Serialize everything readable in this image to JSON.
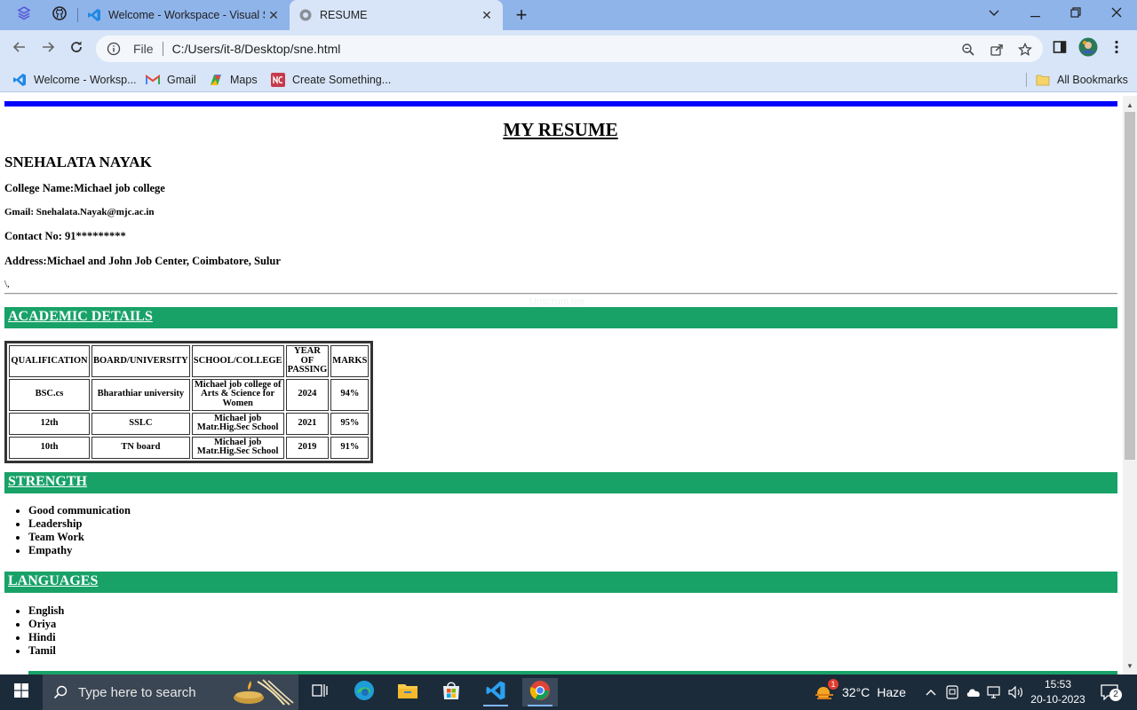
{
  "browser": {
    "tabs": [
      {
        "title": "Welcome - Workspace - Visual S",
        "icon": "vscode-icon"
      },
      {
        "title": "RESUME",
        "icon": "globe-icon"
      }
    ],
    "address_scheme": "File",
    "address_url": "C:/Users/it-8/Desktop/sne.html",
    "bookmarks": [
      {
        "label": "Welcome - Worksp...",
        "icon": "vscode-icon"
      },
      {
        "label": "Gmail",
        "icon": "gmail-icon"
      },
      {
        "label": "Maps",
        "icon": "maps-icon"
      },
      {
        "label": "Create Something...",
        "icon": "create-icon"
      }
    ],
    "all_bookmarks_label": "All Bookmarks"
  },
  "resume": {
    "title": "MY RESUME",
    "name": "SNEHALATA NAYAK",
    "college": "College Name:Michael job college",
    "gmail": "Gmail: Snehalata.Nayak@mjc.ac.in",
    "contact": "Contact No: 91*********",
    "address": "Address:Michael and John Job Center, Coimbatore, Sulur",
    "stray_mark": "\\,",
    "ghost_text": "Unscrum.tee",
    "sections": {
      "academic": "ACADEMIC DETAILS",
      "strength": "STRENGTH",
      "languages": "LANGUAGES"
    },
    "table": {
      "headers": [
        "QUALIFICATION",
        "BOARD/UNIVERSITY",
        "SCHOOL/COLLEGE",
        "YEAR OF PASSING",
        "MARKS"
      ],
      "rows": [
        [
          "BSC.cs",
          "Bharathiar university",
          "Michael job college of Arts & Science for Women",
          "2024",
          "94%"
        ],
        [
          "12th",
          "SSLC",
          "Michael job Matr.Hig.Sec School",
          "2021",
          "95%"
        ],
        [
          "10th",
          "TN board",
          "Michael job Matr.Hig.Sec School",
          "2019",
          "91%"
        ]
      ]
    },
    "strengths": [
      "Good communication",
      "Leadership",
      "Team Work",
      "Empathy"
    ],
    "languages": [
      "English",
      "Oriya",
      "Hindi",
      "Tamil"
    ]
  },
  "taskbar": {
    "search_placeholder": "Type here to search",
    "weather_temp": "32°C",
    "weather_desc": "Haze",
    "weather_badge": "1",
    "time": "15:53",
    "date": "20-10-2023",
    "notifications": "2"
  },
  "colors": {
    "section_green": "#18a268",
    "accent_blue": "#0000ff",
    "tabbar": "#8fb4ea",
    "toolbar": "#d8e5f8",
    "taskbar": "#1c2b3a"
  }
}
